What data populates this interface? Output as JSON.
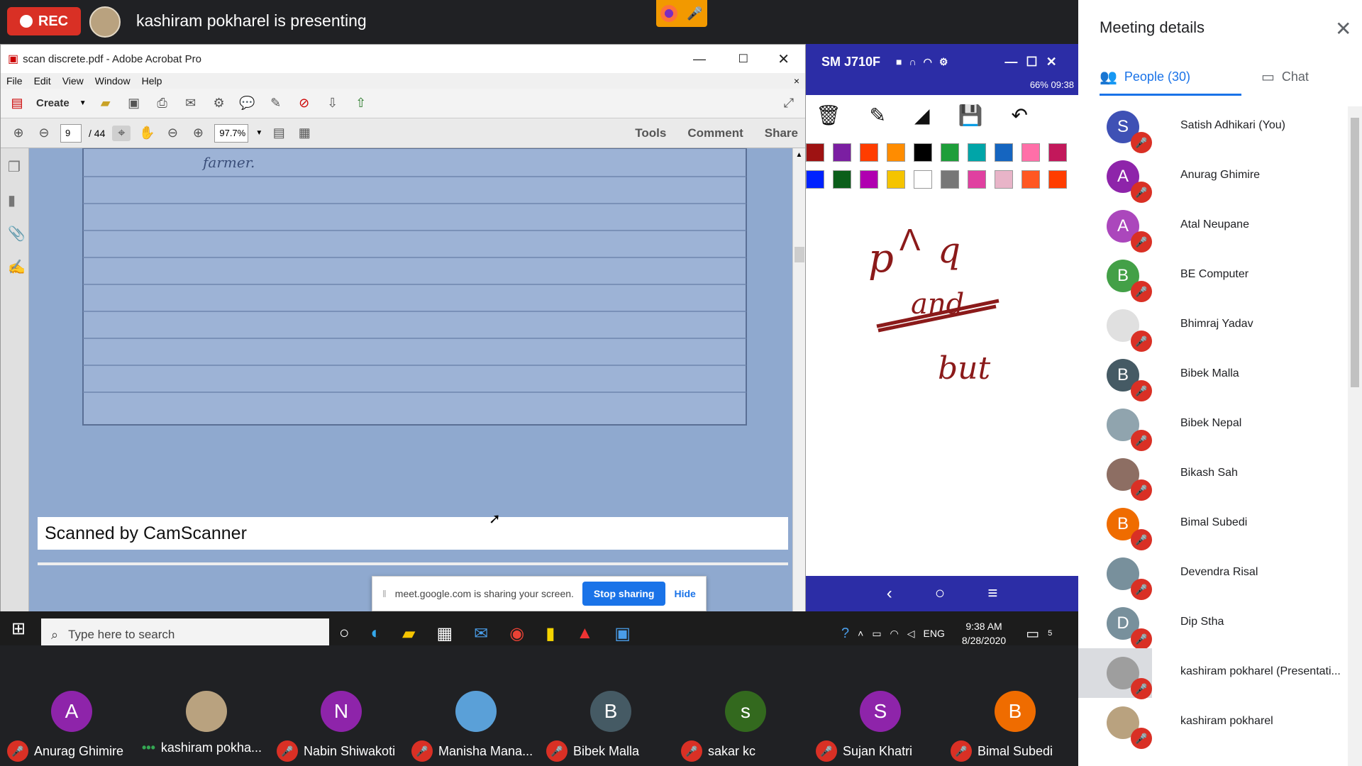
{
  "meet_top": {
    "rec_label": "REC",
    "presenting_text": "kashiram pokharel is presenting"
  },
  "acrobat": {
    "title": "scan discrete.pdf - Adobe Acrobat Pro",
    "menu": [
      "File",
      "Edit",
      "View",
      "Window",
      "Help"
    ],
    "create_label": "Create",
    "page_current": "9",
    "page_total": "/ 44",
    "zoom": "97.7%",
    "panes": [
      "Tools",
      "Comment",
      "Share"
    ],
    "doc_text": "farmer.",
    "scanned_by": "Scanned by CamScanner"
  },
  "phone": {
    "device_name": "SM J710F",
    "status_text": "66%  09:38",
    "ink_words": [
      "p",
      "q",
      "and",
      "but"
    ]
  },
  "sharebar": {
    "text": "meet.google.com is sharing your screen.",
    "stop_label": "Stop sharing",
    "hide_label": "Hide"
  },
  "taskbar": {
    "search_placeholder": "Type here to search",
    "language": "ENG",
    "time": "9:38 AM",
    "date": "8/28/2020",
    "notif_count": "5"
  },
  "strip": [
    {
      "name": "Anurag Ghimire",
      "initial": "A",
      "color": "#8e24aa",
      "muted": true
    },
    {
      "name": "kashiram pokha...",
      "initial": "",
      "color": "#b9a27f",
      "muted": false
    },
    {
      "name": "Nabin Shiwakoti",
      "initial": "N",
      "color": "#8e24aa",
      "muted": true
    },
    {
      "name": "Manisha Mana...",
      "initial": "",
      "color": "#5aa0d8",
      "muted": true
    },
    {
      "name": "Bibek Malla",
      "initial": "B",
      "color": "#455a64",
      "muted": true
    },
    {
      "name": "sakar kc",
      "initial": "s",
      "color": "#33691e",
      "muted": true
    },
    {
      "name": "Sujan Khatri",
      "initial": "S",
      "color": "#8e24aa",
      "muted": true
    },
    {
      "name": "Bimal Subedi",
      "initial": "B",
      "color": "#ef6c00",
      "muted": true
    }
  ],
  "panel": {
    "title": "Meeting details",
    "people_tab": "People (30)",
    "chat_tab": "Chat",
    "people": [
      {
        "name": "Satish Adhikari (You)",
        "initial": "S",
        "color": "#3f51b5"
      },
      {
        "name": "Anurag Ghimire",
        "initial": "A",
        "color": "#8e24aa"
      },
      {
        "name": "Atal Neupane",
        "initial": "A",
        "color": "#ab47bc"
      },
      {
        "name": "BE Computer",
        "initial": "B",
        "color": "#43a047"
      },
      {
        "name": "Bhimraj Yadav",
        "initial": "",
        "color": "#e0e0e0"
      },
      {
        "name": "Bibek Malla",
        "initial": "B",
        "color": "#455a64"
      },
      {
        "name": "Bibek Nepal",
        "initial": "",
        "color": "#90a4ae"
      },
      {
        "name": "Bikash Sah",
        "initial": "",
        "color": "#8d6e63"
      },
      {
        "name": "Bimal Subedi",
        "initial": "B",
        "color": "#ef6c00"
      },
      {
        "name": "Devendra Risal",
        "initial": "",
        "color": "#78909c"
      },
      {
        "name": "Dip Stha",
        "initial": "D",
        "color": "#78909c"
      },
      {
        "name": "kashiram pokharel (Presentati...",
        "initial": "",
        "color": "#9e9e9e"
      },
      {
        "name": "kashiram pokharel",
        "initial": "",
        "color": "#b9a27f"
      }
    ]
  },
  "colors": {
    "meet_red": "#d93025",
    "meet_blue": "#1a73e8",
    "phone_blue": "#2c2da6"
  }
}
